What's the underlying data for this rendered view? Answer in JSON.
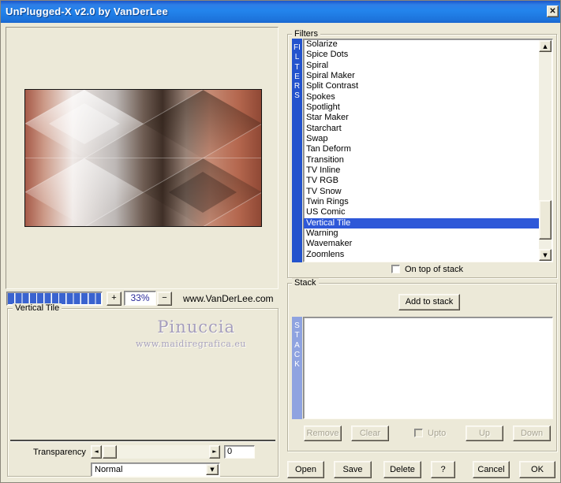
{
  "window": {
    "title": "UnPlugged-X v2.0 by VanDerLee"
  },
  "icons": {
    "close": "✕",
    "up": "▲",
    "down": "▼",
    "left": "◄",
    "right": "►",
    "dropdown": "▼"
  },
  "preview": {
    "zoom_in": "+",
    "zoom_out": "−",
    "zoom_level": "33%",
    "website": "www.VanDerLee.com"
  },
  "filters": {
    "label": "Filters",
    "band": "FILTERS",
    "items": [
      "Solarize",
      "Spice Dots",
      "Spiral",
      "Spiral Maker",
      "Split Contrast",
      "Spokes",
      "Spotlight",
      "Star Maker",
      "Starchart",
      "Swap",
      "Tan Deform",
      "Transition",
      "TV Inline",
      "TV RGB",
      "TV Snow",
      "Twin Rings",
      "US Comic",
      "Vertical Tile",
      "Warning",
      "Wavemaker",
      "Zoomlens"
    ],
    "selected": "Vertical Tile",
    "on_top_label": "On top of stack"
  },
  "stack": {
    "label": "Stack",
    "band": "STACK",
    "add_button": "Add to stack",
    "remove_button": "Remove",
    "clear_button": "Clear",
    "upto_label": "Upto",
    "up_button": "Up",
    "down_button": "Down"
  },
  "settings": {
    "label": "Vertical Tile",
    "transparency_label": "Transparency",
    "transparency_value": "0",
    "blend_mode": "Normal"
  },
  "watermark": {
    "name": "Pinuccia",
    "site": "www.maidiregrafica.eu"
  },
  "actions": {
    "open": "Open",
    "save": "Save",
    "delete": "Delete",
    "help": "?",
    "cancel": "Cancel",
    "ok": "OK"
  },
  "colors": {
    "titlebar_blue": "#2080e8",
    "filters_band": "#2353cd",
    "stack_band": "#8fa3e0",
    "selection": "#2e58d8",
    "progress_segment": "#3a63cf",
    "dialog_beige": "#ece9d8"
  }
}
